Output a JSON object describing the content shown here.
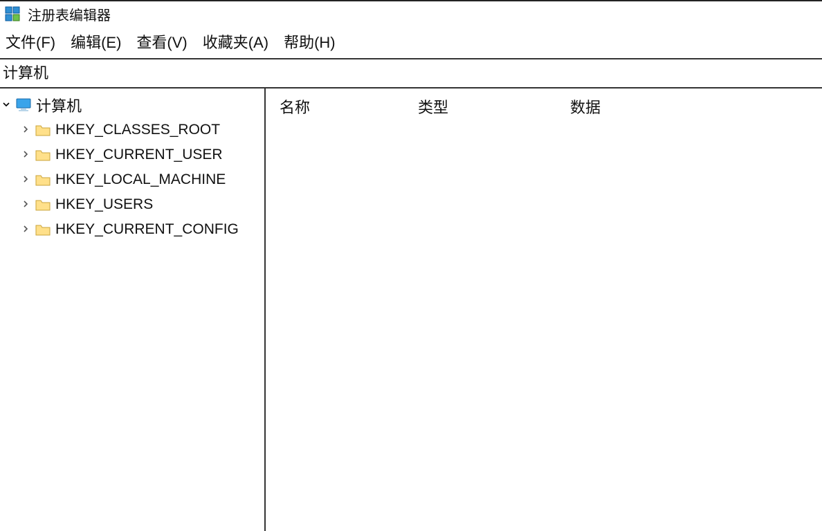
{
  "title": "注册表编辑器",
  "menu": {
    "file": "文件(F)",
    "edit": "编辑(E)",
    "view": "查看(V)",
    "favorites": "收藏夹(A)",
    "help": "帮助(H)"
  },
  "addressBar": "计算机",
  "tree": {
    "root": "计算机",
    "items": [
      {
        "label": "HKEY_CLASSES_ROOT"
      },
      {
        "label": "HKEY_CURRENT_USER"
      },
      {
        "label": "HKEY_LOCAL_MACHINE"
      },
      {
        "label": "HKEY_USERS"
      },
      {
        "label": "HKEY_CURRENT_CONFIG"
      }
    ]
  },
  "columns": {
    "name": "名称",
    "type": "类型",
    "data": "数据"
  }
}
